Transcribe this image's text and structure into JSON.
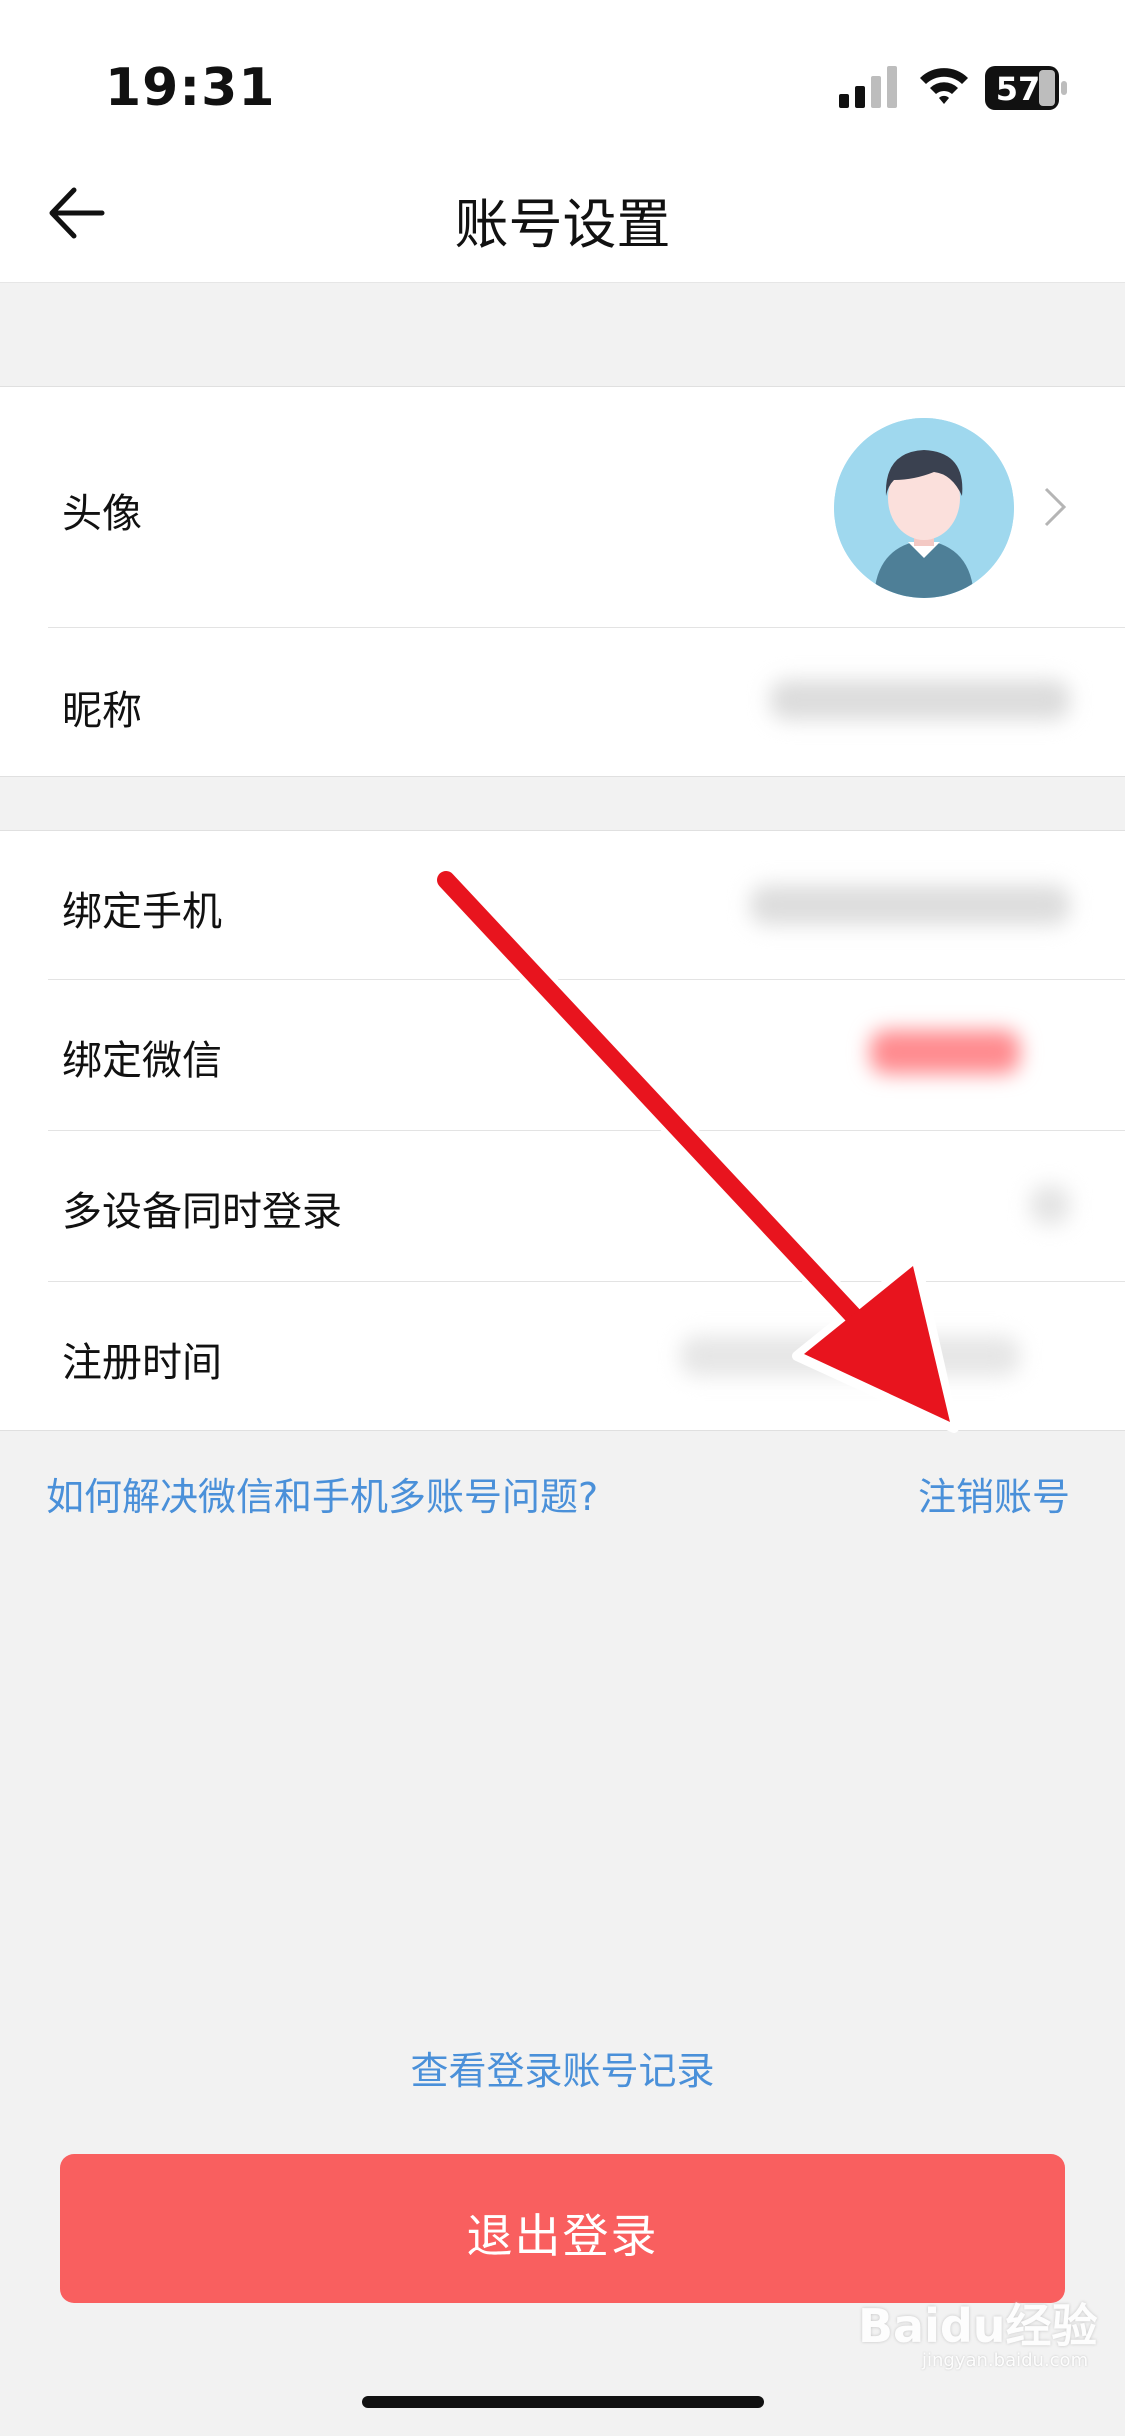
{
  "status_bar": {
    "time": "19:31",
    "battery": "57"
  },
  "nav": {
    "title": "账号设置"
  },
  "settings": {
    "avatar_label": "头像",
    "nickname_label": "昵称",
    "bind_phone_label": "绑定手机",
    "bind_wechat_label": "绑定微信",
    "multi_device_label": "多设备同时登录",
    "register_time_label": "注册时间"
  },
  "links": {
    "help": "如何解决微信和手机多账号问题?",
    "cancel_account": "注销账号",
    "login_history": "查看登录账号记录"
  },
  "logout": {
    "label": "退出登录"
  },
  "watermark": {
    "text": "Baidu经验",
    "sub": "jingyan.baidu.com"
  },
  "colors": {
    "accent_link": "#4a90d9",
    "logout_bg": "#f95f5f",
    "annotation_arrow": "#e8141e"
  }
}
